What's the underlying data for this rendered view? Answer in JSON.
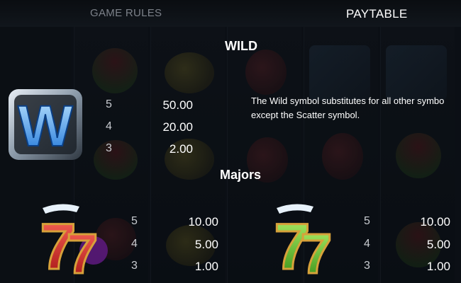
{
  "tabs": {
    "game_rules": "GAME RULES",
    "paytable": "PAYTABLE"
  },
  "wild": {
    "title": "WILD",
    "symbol_letter": "W",
    "rows": [
      {
        "count": "5",
        "payout": "50.00"
      },
      {
        "count": "4",
        "payout": "20.00"
      },
      {
        "count": "3",
        "payout": "2.00"
      }
    ],
    "description_line1": "The Wild symbol substitutes for all other symbo",
    "description_line2": "except the Scatter symbol."
  },
  "majors": {
    "title": "Majors",
    "red_seven": {
      "glyph": "7",
      "rows": [
        {
          "count": "5",
          "payout": "10.00"
        },
        {
          "count": "4",
          "payout": "5.00"
        },
        {
          "count": "3",
          "payout": "1.00"
        }
      ]
    },
    "green_seven": {
      "glyph": "7",
      "rows": [
        {
          "count": "5",
          "payout": "10.00"
        },
        {
          "count": "4",
          "payout": "5.00"
        },
        {
          "count": "3",
          "payout": "1.00"
        }
      ]
    }
  },
  "colors": {
    "wild_ice": "#7fb6e8",
    "wild_letter": "#2f8fe6",
    "red_seven": "#d62b2b",
    "green_seven": "#6ccc2c"
  }
}
